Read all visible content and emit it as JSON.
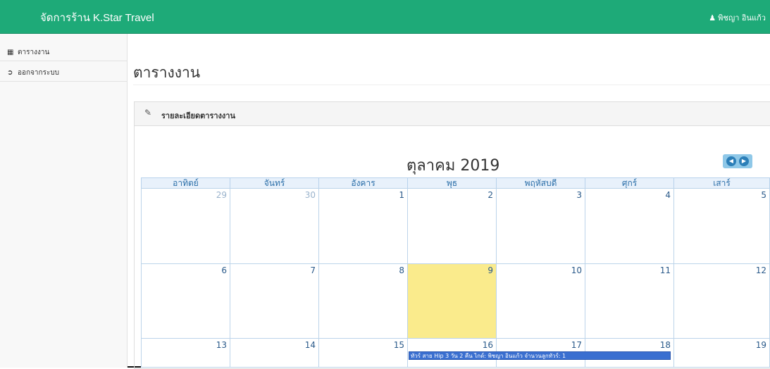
{
  "header": {
    "brand": "จัดการร้าน K.Star Travel",
    "user_name": "พิชญา อินแก้ว",
    "user_icon": "user-icon"
  },
  "sidebar": {
    "items": [
      {
        "label": "ตารางงาน",
        "icon": "calendar-icon"
      },
      {
        "label": "ออกจากระบบ",
        "icon": "sign-out-icon"
      }
    ]
  },
  "main": {
    "page_title": "ตารางงาน",
    "panel_title": "รายละเอียดตารางงาน",
    "panel_icon": "edit-icon"
  },
  "calendar": {
    "month_title": "ตุลาคม 2019",
    "weekdays": [
      "อาทิตย์",
      "จันทร์",
      "อังคาร",
      "พุธ",
      "พฤหัสบดี",
      "ศุกร์",
      "เสาร์"
    ],
    "weeks": [
      [
        "29",
        "30",
        "1",
        "2",
        "3",
        "4",
        "5"
      ],
      [
        "6",
        "7",
        "8",
        "9",
        "10",
        "11",
        "12"
      ],
      [
        "13",
        "14",
        "15",
        "16",
        "17",
        "18",
        "19"
      ]
    ],
    "today": "9",
    "event": "ทัวร์ สาย Hip 3 วัน 2 คืน ไกด์: พิชญา อินแก้ว จำนวนลูกทัวร์: 1",
    "colors": {
      "today": "#faeb8c",
      "event": "#3a6fd0",
      "header": "#1eaa78"
    }
  }
}
